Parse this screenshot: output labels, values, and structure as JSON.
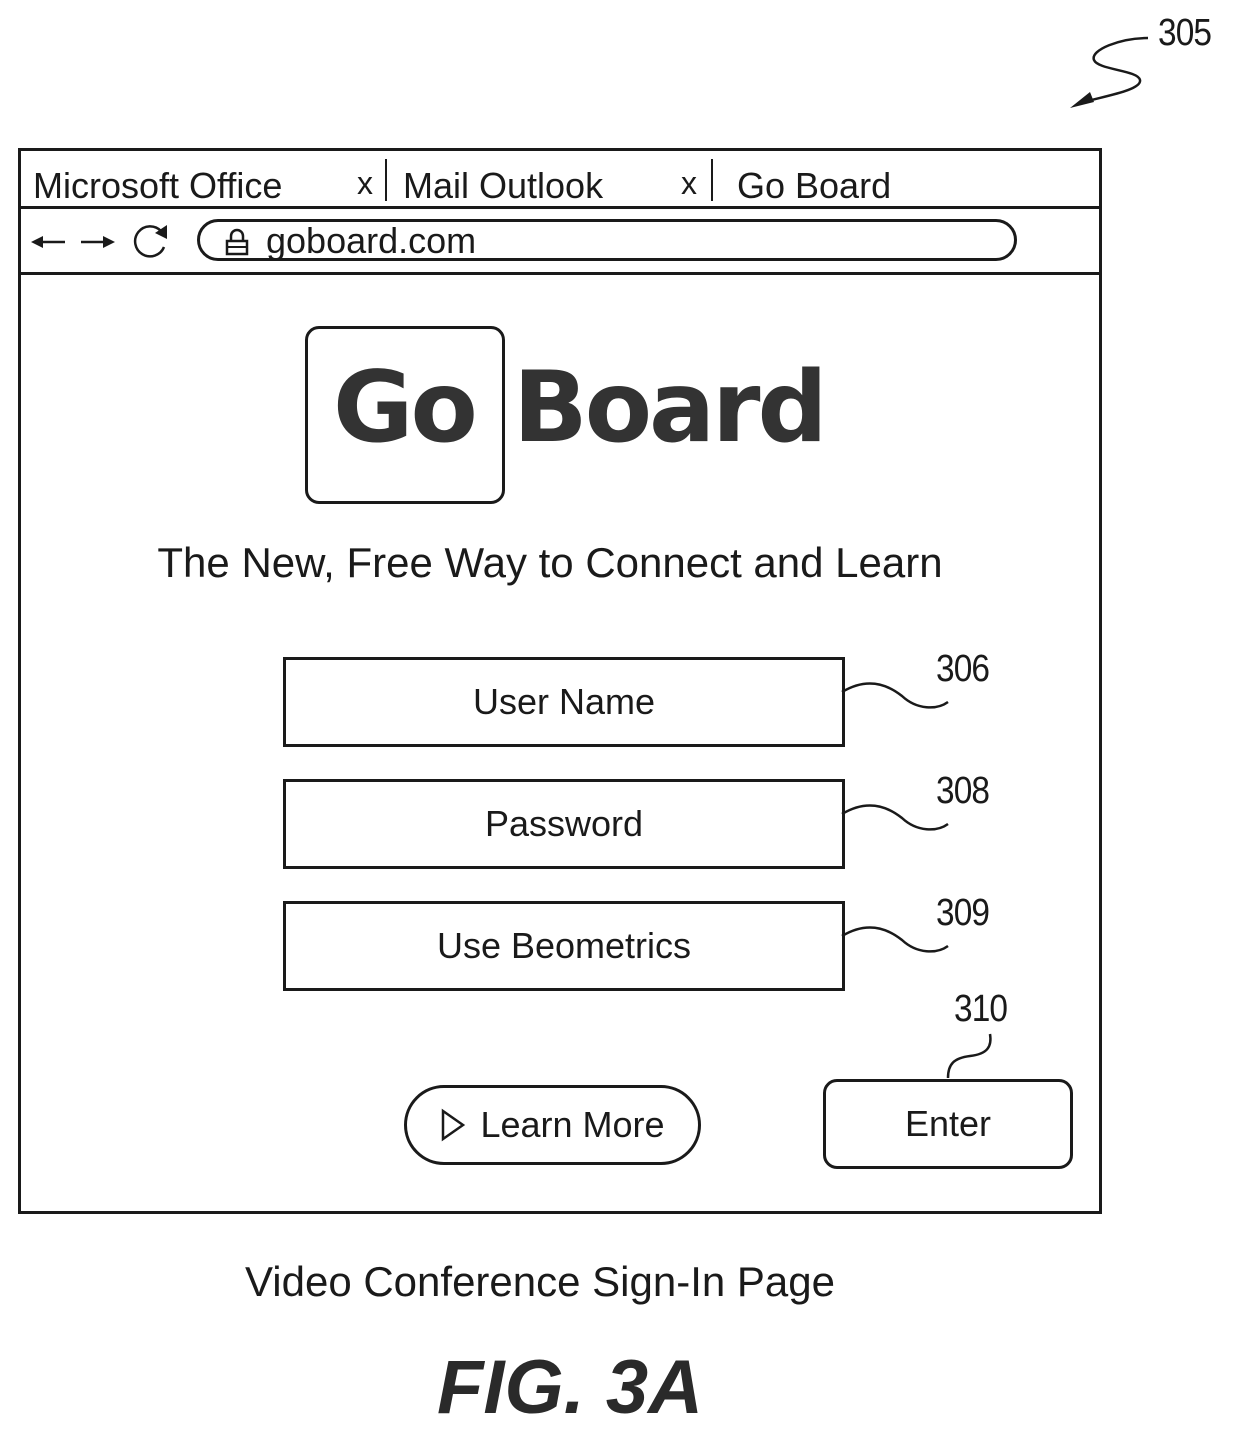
{
  "figure": {
    "ref_numeral": "305",
    "caption": "Video Conference Sign-In Page",
    "label": "FIG. 3A"
  },
  "browser": {
    "tabs": [
      {
        "label": "Microsoft Office",
        "close": "x"
      },
      {
        "label": "Mail Outlook",
        "close": "x"
      },
      {
        "label": "Go Board"
      }
    ],
    "nav": {
      "back_icon": "arrow-left-icon",
      "forward_icon": "arrow-right-icon",
      "reload_icon": "reload-icon",
      "lock_icon": "lock-icon",
      "url": "goboard.com"
    }
  },
  "page": {
    "logo": {
      "part1": "Go",
      "part2": "Board"
    },
    "tagline": "The New, Free Way to Connect and Learn",
    "fields": [
      {
        "label": "User Name",
        "ref": "306"
      },
      {
        "label": "Password",
        "ref": "308"
      },
      {
        "label": "Use Beometrics",
        "ref": "309"
      }
    ],
    "learn_more": {
      "label": "Learn More",
      "icon": "play-icon"
    },
    "enter": {
      "label": "Enter",
      "ref": "310"
    }
  }
}
